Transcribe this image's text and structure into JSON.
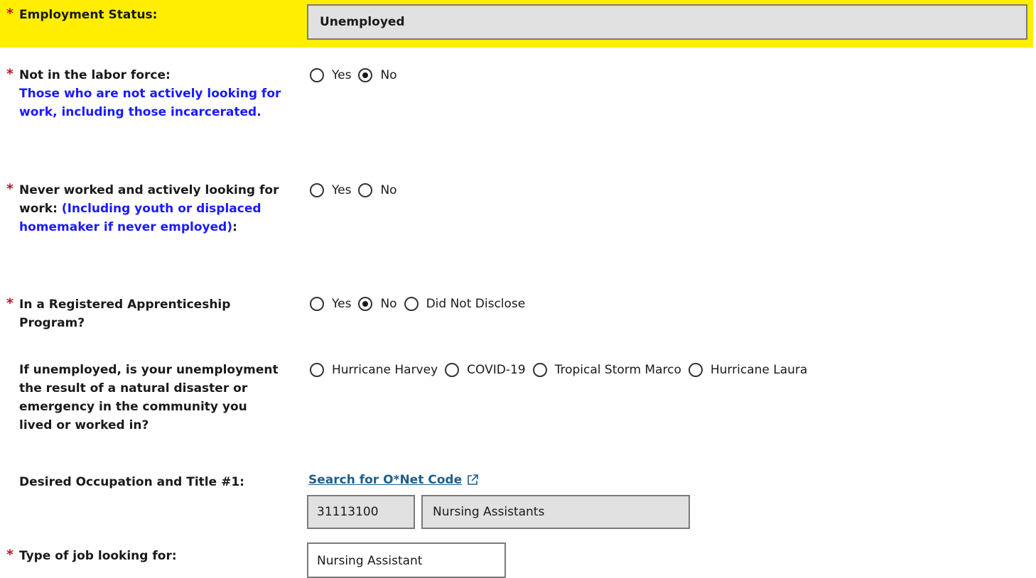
{
  "employment_status": {
    "label": "Employment Status:",
    "value": "Unemployed",
    "highlight_color": "#ffee00"
  },
  "not_in_labor_force": {
    "label": "Not in the labor force:",
    "note": "Those who are not actively looking for work, including those incarcerated.",
    "options": [
      "Yes",
      "No"
    ],
    "selected": "No"
  },
  "never_worked": {
    "label_main": "Never worked and actively looking for work:",
    "label_note": "(Including youth or displaced homemaker if never employed)",
    "label_suffix": ":",
    "options": [
      "Yes",
      "No"
    ],
    "selected": null
  },
  "apprenticeship": {
    "label": "In a Registered Apprenticeship Program?",
    "options": [
      "Yes",
      "No",
      "Did Not Disclose"
    ],
    "selected": "No"
  },
  "disaster": {
    "label": "If unemployed, is your unemployment the result of a natural disaster or emergency in the community you lived or worked in?",
    "options": [
      "Hurricane Harvey",
      "COVID-19",
      "Tropical Storm Marco",
      "Hurricane Laura"
    ],
    "selected": null
  },
  "desired_occupation": {
    "label": "Desired Occupation and Title #1:",
    "link_text": "Search for O*Net Code",
    "code": "31113100",
    "title": "Nursing Assistants"
  },
  "job_type": {
    "label": "Type of job looking for:",
    "value": "Nursing Assistant"
  },
  "colors": {
    "required_star": "#c0142b",
    "note_blue": "#1a1aff",
    "link": "#1f5f8b"
  }
}
